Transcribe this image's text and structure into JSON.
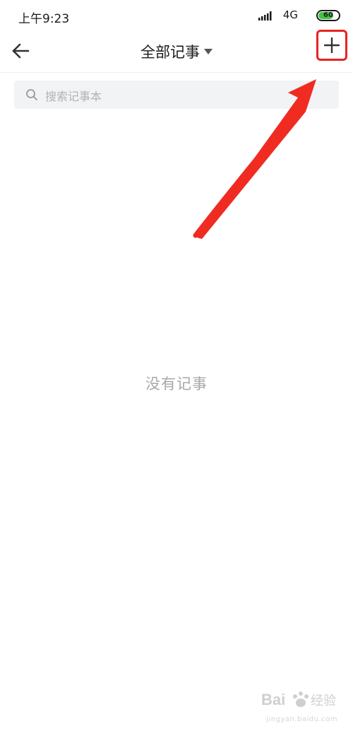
{
  "status_bar": {
    "time": "上午9:23",
    "network": "4G",
    "battery_level": "60",
    "battery_fraction": 0.75
  },
  "header": {
    "back_icon": "arrow-left-icon",
    "title": "全部记事",
    "dropdown_icon": "caret-down-icon",
    "add_icon": "plus-icon"
  },
  "search": {
    "icon": "search-icon",
    "placeholder": "搜索记事本"
  },
  "main": {
    "empty_message": "没有记事"
  },
  "annotation": {
    "color": "#e8231f",
    "points_to": "add-button"
  },
  "watermark": {
    "logo_text": "Bai 经验",
    "url": "jingyan.baidu.com"
  },
  "colors": {
    "accent_red": "#e8231f",
    "text_primary": "#1a1a1a",
    "text_muted": "#a8a8a8",
    "search_bg": "#f2f3f5"
  }
}
